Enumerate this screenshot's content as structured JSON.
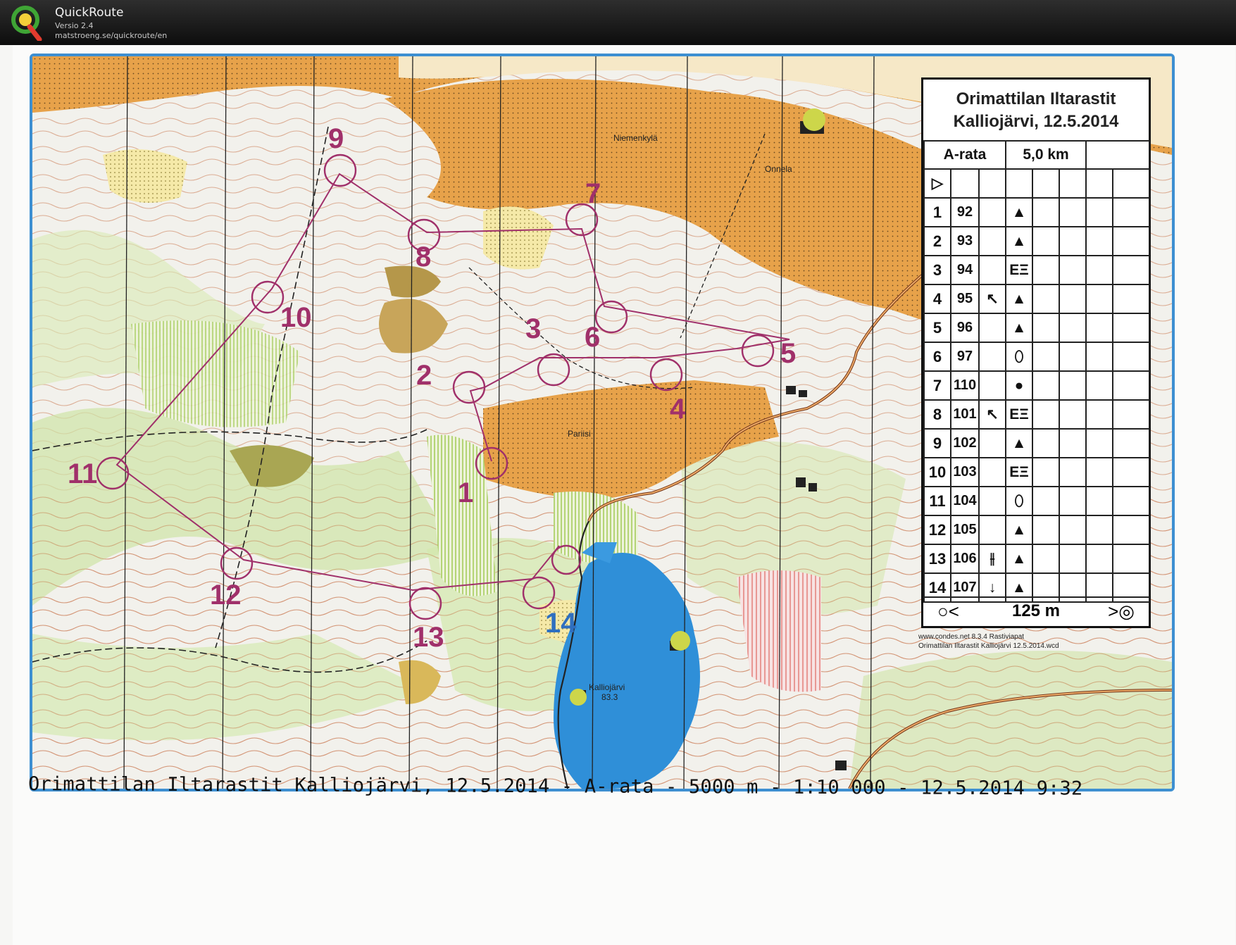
{
  "app": {
    "name": "QuickRoute",
    "version": "Versio 2.4",
    "url": "matstroeng.se/quickroute/en",
    "logo_icon": "quickroute-q-logo"
  },
  "map": {
    "place_labels": [
      "Niemenkylä",
      "Onnela",
      "Pariisi",
      "Kalliojärvi",
      "83.3"
    ],
    "course_color": "#a0306a",
    "water_color": "#2f8fd8",
    "field_color": "#e8a13c"
  },
  "controls": {
    "labels": [
      "1",
      "2",
      "3",
      "4",
      "5",
      "6",
      "7",
      "8",
      "9",
      "10",
      "11",
      "12",
      "13",
      "14"
    ]
  },
  "legend": {
    "title_line1": "Orimattilan Iltarastit",
    "title_line2": "Kalliojärvi, 12.5.2014",
    "course": "A-rata",
    "distance": "5,0 km",
    "start_symbol": "▷",
    "rows": [
      {
        "num": "1",
        "code": "92",
        "dir": "",
        "sym": "▲"
      },
      {
        "num": "2",
        "code": "93",
        "dir": "",
        "sym": "▲"
      },
      {
        "num": "3",
        "code": "94",
        "dir": "",
        "sym": "ΕΞ"
      },
      {
        "num": "4",
        "code": "95",
        "dir": "↖",
        "sym": "▲"
      },
      {
        "num": "5",
        "code": "96",
        "dir": "",
        "sym": "▲"
      },
      {
        "num": "6",
        "code": "97",
        "dir": "",
        "sym": "⬯"
      },
      {
        "num": "7",
        "code": "110",
        "dir": "",
        "sym": "●"
      },
      {
        "num": "8",
        "code": "101",
        "dir": "↖",
        "sym": "ΕΞ"
      },
      {
        "num": "9",
        "code": "102",
        "dir": "",
        "sym": "▲"
      },
      {
        "num": "10",
        "code": "103",
        "dir": "",
        "sym": "ΕΞ"
      },
      {
        "num": "11",
        "code": "104",
        "dir": "",
        "sym": "⬯"
      },
      {
        "num": "12",
        "code": "105",
        "dir": "",
        "sym": "▲"
      },
      {
        "num": "13",
        "code": "106",
        "dir": "⫲",
        "sym": "▲"
      },
      {
        "num": "14",
        "code": "107",
        "dir": "↓",
        "sym": "▲"
      }
    ],
    "finish_distance": "125 m",
    "finish_left_symbol": "○<",
    "finish_right_symbol": ">◎",
    "credit_line1": "www.condes.net 8.3.4 Rastiviapat",
    "credit_line2": "Orimattilan Iltarastit Kalliojärvi 12.5.2014.wcd"
  },
  "caption": "Orimattilan Iltarastit Kalliojärvi, 12.5.2014 - A-rata - 5000 m - 1:10 000 - 12.5.2014 9:32"
}
